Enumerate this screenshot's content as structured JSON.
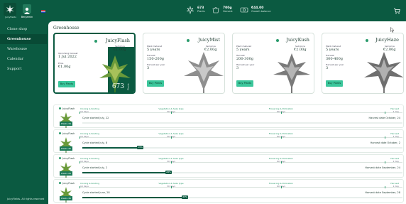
{
  "brand": {
    "name": "JuicyFields"
  },
  "user": {
    "name": "Benjamin"
  },
  "stats": [
    {
      "icon": "plant-icon",
      "value": "673",
      "label": "Plants"
    },
    {
      "icon": "harvest-icon",
      "value": "700g",
      "label": "Harvest"
    },
    {
      "icon": "money-icon",
      "value": "€44.00",
      "label": "Growth balance"
    }
  ],
  "nav": {
    "items": [
      "Clone shop",
      "Greenhouse",
      "Warehouse",
      "Calendar",
      "Support"
    ],
    "active": "Greenhouse",
    "footer": "JuicyFields. All rights reserved"
  },
  "page": {
    "title": "Greenhouse"
  },
  "cards": [
    {
      "name": "JuicyFlash",
      "sell_label": "Sell price",
      "sell_price": "€1.00g",
      "date_label": "Upcoming harvest",
      "date": "1 Jul 2022",
      "price_label": "Price",
      "price": "€1.00g",
      "buy": "Buy Plants",
      "available": "673",
      "available_label": "Plants"
    },
    {
      "name": "JuicyMist",
      "life_label": "Plant matured",
      "life": "5 years",
      "sell_label": "Sell price",
      "sell_price": "€2.00g",
      "harvest_label": "Harvest",
      "harvest": "150-200g",
      "per_label": "Harvest per year",
      "per": "3",
      "buy": "Buy Plants"
    },
    {
      "name": "JuicyKush",
      "life_label": "Plant matured",
      "life": "5 years",
      "sell_label": "Sell price",
      "sell_price": "€2.00g",
      "harvest_label": "Harvest",
      "harvest": "200-300g",
      "per_label": "Harvest per year",
      "per": "3",
      "buy": "Buy Plants"
    },
    {
      "name": "JuicyHaze",
      "life_label": "Plant matured",
      "life": "5 years",
      "sell_label": "Sell price",
      "sell_price": "€2.00g",
      "harvest_label": "Harvest",
      "harvest": "300-400g",
      "per_label": "Harvest per year",
      "per": "3",
      "buy": "Buy Plants"
    }
  ],
  "phases": [
    {
      "name": "Cloning & Rooting",
      "days": "10 days"
    },
    {
      "name": "Vegetation & Seks type",
      "days": "30 days"
    },
    {
      "name": "Flowering & Pollination",
      "days": "60 days"
    },
    {
      "name": "Harvest",
      "days": "1 day"
    }
  ],
  "cycles": [
    {
      "strain": "JuicyFlash",
      "plants": "Plants 34",
      "started": "Cycle started July, 22",
      "harvest": "Harvest date October, 24",
      "progress": 0,
      "progress_label": ""
    },
    {
      "strain": "JuicyFlash",
      "plants": "Plants 40",
      "started": "Cycle started July, 8",
      "harvest": "Harvest date October, 2",
      "progress": 0.19,
      "progress_label": "19%"
    },
    {
      "strain": "JuicyFlash",
      "plants": "Plants 29",
      "started": "Cycle started July, 2",
      "harvest": "Harvest date September, 24",
      "progress": 0.28,
      "progress_label": "28%"
    },
    {
      "strain": "JuicyFlash",
      "plants": "Plants 36",
      "started": "Cycle started June, 28",
      "harvest": "Harvest date September, 28",
      "progress": 0.33,
      "progress_label": "33%"
    }
  ]
}
